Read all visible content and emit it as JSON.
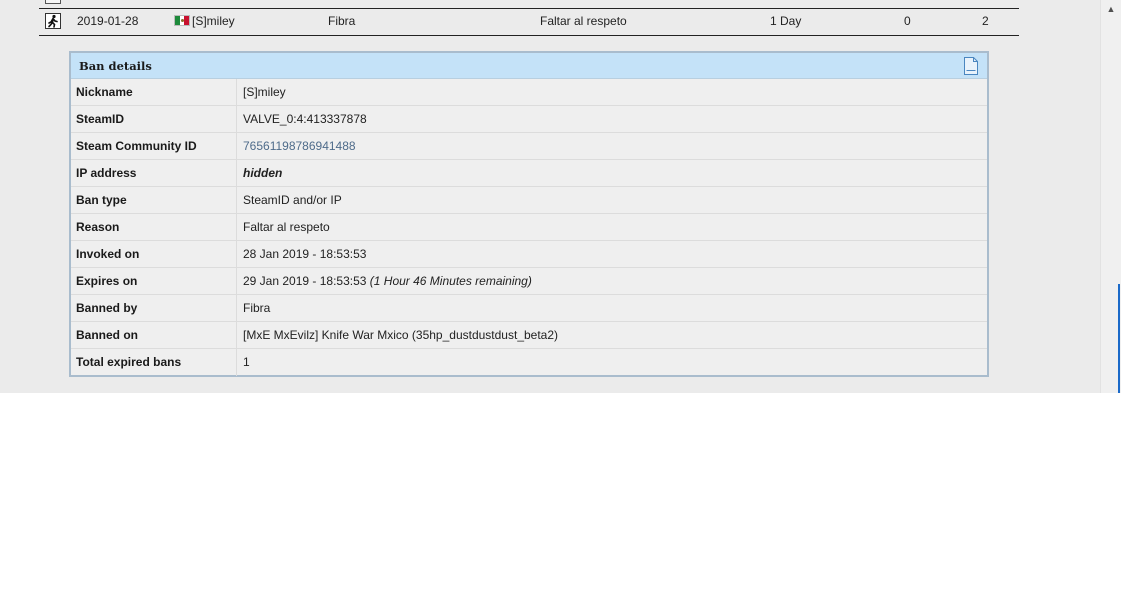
{
  "ban_list": {
    "row": {
      "date": "2019-01-28",
      "country_flag_icon": "mexico-flag-icon",
      "nickname": "[S]miley",
      "admin": "Fibra",
      "reason": "Faltar al respeto",
      "length": "1 Day",
      "col6": "0",
      "col7": "2"
    }
  },
  "ban_details": {
    "title": "Ban details",
    "rows": [
      {
        "label": "Nickname",
        "value": "[S]miley"
      },
      {
        "label": "SteamID",
        "value": "VALVE_0:4:413337878"
      },
      {
        "label": "Steam Community ID",
        "value": "76561198786941488"
      },
      {
        "label": "IP address",
        "value": "hidden"
      },
      {
        "label": "Ban type",
        "value": "SteamID and/or IP"
      },
      {
        "label": "Reason",
        "value": "Faltar al respeto"
      },
      {
        "label": "Invoked on",
        "value": "28 Jan 2019 - 18:53:53"
      },
      {
        "label": "Expires on",
        "value": "29 Jan 2019 - 18:53:53",
        "extra": "(1 Hour 46 Minutes remaining)"
      },
      {
        "label": "Banned by",
        "value": "Fibra"
      },
      {
        "label": "Banned on",
        "value": "[MxE MxEvilz] Knife War Mxico (35hp_dustdustdust_beta2)"
      },
      {
        "label": "Total expired bans",
        "value": "1"
      }
    ]
  },
  "scrollbar": {
    "up_arrow": "▲"
  }
}
